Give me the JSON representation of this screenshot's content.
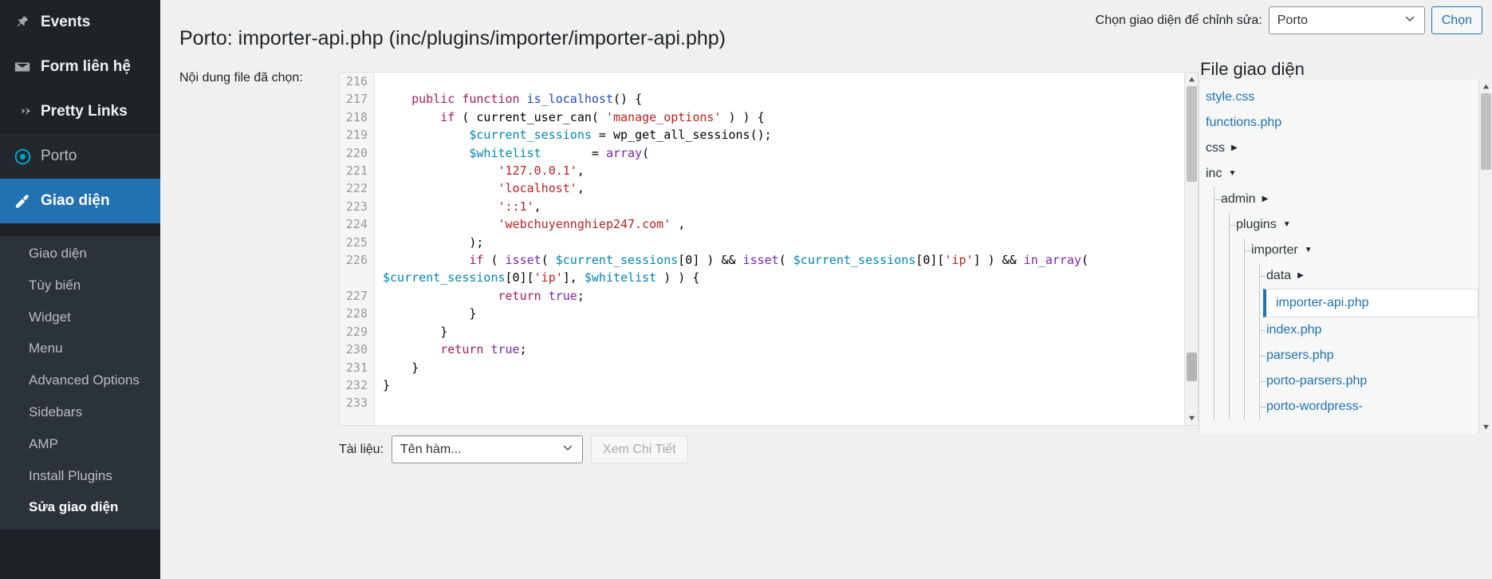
{
  "sidebar": {
    "top_items": [
      {
        "label": "Events",
        "icon": "pin-icon",
        "state": "normal"
      },
      {
        "label": "Form liên hệ",
        "icon": "mail-icon",
        "state": "normal"
      },
      {
        "label": "Pretty Links",
        "icon": "pretty-links-icon",
        "state": "normal"
      },
      {
        "label": "Porto",
        "icon": "porto-icon",
        "state": "highlighted"
      },
      {
        "label": "Giao diện",
        "icon": "appearance-brush-icon",
        "state": "current"
      }
    ],
    "submenu": [
      {
        "label": "Giao diện",
        "active": false
      },
      {
        "label": "Tùy biến",
        "active": false
      },
      {
        "label": "Widget",
        "active": false
      },
      {
        "label": "Menu",
        "active": false
      },
      {
        "label": "Advanced Options",
        "active": false
      },
      {
        "label": "Sidebars",
        "active": false
      },
      {
        "label": "AMP",
        "active": false
      },
      {
        "label": "Install Plugins",
        "active": false
      },
      {
        "label": "Sửa giao diện",
        "active": true
      }
    ]
  },
  "header": {
    "page_title": "Porto: importer-api.php (inc/plugins/importer/importer-api.php)",
    "content_label": "Nội dung file đã chọn:",
    "theme_picker_label": "Chọn giao diện để chỉnh sửa:",
    "theme_selected": "Porto",
    "theme_options": [
      "Porto"
    ],
    "select_button": "Chọn"
  },
  "editor": {
    "lines": [
      {
        "num": "216",
        "tokens": []
      },
      {
        "num": "217",
        "tokens": [
          {
            "t": "    ",
            "c": "pn"
          },
          {
            "t": "public",
            "c": "kw"
          },
          {
            "t": " ",
            "c": "pn"
          },
          {
            "t": "function",
            "c": "kw"
          },
          {
            "t": " ",
            "c": "pn"
          },
          {
            "t": "is_localhost",
            "c": "fn"
          },
          {
            "t": "() {",
            "c": "pn"
          }
        ]
      },
      {
        "num": "218",
        "tokens": [
          {
            "t": "        ",
            "c": "pn"
          },
          {
            "t": "if",
            "c": "kw"
          },
          {
            "t": " ( current_user_can( ",
            "c": "pn"
          },
          {
            "t": "'manage_options'",
            "c": "str"
          },
          {
            "t": " ) ) {",
            "c": "pn"
          }
        ]
      },
      {
        "num": "219",
        "tokens": [
          {
            "t": "            ",
            "c": "pn"
          },
          {
            "t": "$current_sessions",
            "c": "var"
          },
          {
            "t": " = wp_get_all_sessions();",
            "c": "pn"
          }
        ]
      },
      {
        "num": "220",
        "tokens": [
          {
            "t": "            ",
            "c": "pn"
          },
          {
            "t": "$whitelist",
            "c": "var"
          },
          {
            "t": "       = ",
            "c": "pn"
          },
          {
            "t": "array",
            "c": "kw2"
          },
          {
            "t": "(",
            "c": "pn"
          }
        ]
      },
      {
        "num": "221",
        "tokens": [
          {
            "t": "                ",
            "c": "pn"
          },
          {
            "t": "'127.0.0.1'",
            "c": "str"
          },
          {
            "t": ",",
            "c": "pn"
          }
        ]
      },
      {
        "num": "222",
        "tokens": [
          {
            "t": "                ",
            "c": "pn"
          },
          {
            "t": "'localhost'",
            "c": "str"
          },
          {
            "t": ",",
            "c": "pn"
          }
        ]
      },
      {
        "num": "223",
        "tokens": [
          {
            "t": "                ",
            "c": "pn"
          },
          {
            "t": "'::1'",
            "c": "str"
          },
          {
            "t": ",",
            "c": "pn"
          }
        ]
      },
      {
        "num": "224",
        "tokens": [
          {
            "t": "                ",
            "c": "pn"
          },
          {
            "t": "'webchuyennghiep247.com'",
            "c": "str"
          },
          {
            "t": " ,",
            "c": "pn"
          }
        ]
      },
      {
        "num": "225",
        "tokens": [
          {
            "t": "            );",
            "c": "pn"
          }
        ]
      },
      {
        "num": "226",
        "tokens": [
          {
            "t": "            ",
            "c": "pn"
          },
          {
            "t": "if",
            "c": "kw"
          },
          {
            "t": " ( ",
            "c": "pn"
          },
          {
            "t": "isset",
            "c": "kw2"
          },
          {
            "t": "( ",
            "c": "pn"
          },
          {
            "t": "$current_sessions",
            "c": "var"
          },
          {
            "t": "[0] ) && ",
            "c": "pn"
          },
          {
            "t": "isset",
            "c": "kw2"
          },
          {
            "t": "( ",
            "c": "pn"
          },
          {
            "t": "$current_sessions",
            "c": "var"
          },
          {
            "t": "[0][",
            "c": "pn"
          },
          {
            "t": "'ip'",
            "c": "str"
          },
          {
            "t": "] ) && ",
            "c": "pn"
          },
          {
            "t": "in_array",
            "c": "kw2"
          },
          {
            "t": "(",
            "c": "pn"
          }
        ],
        "wrap": [
          {
            "t": "$current_sessions",
            "c": "var"
          },
          {
            "t": "[0][",
            "c": "pn"
          },
          {
            "t": "'ip'",
            "c": "str"
          },
          {
            "t": "], ",
            "c": "pn"
          },
          {
            "t": "$whitelist",
            "c": "var"
          },
          {
            "t": " ) ) {",
            "c": "pn"
          }
        ]
      },
      {
        "num": "227",
        "tokens": [
          {
            "t": "                ",
            "c": "pn"
          },
          {
            "t": "return",
            "c": "kw"
          },
          {
            "t": " ",
            "c": "pn"
          },
          {
            "t": "true",
            "c": "kw2"
          },
          {
            "t": ";",
            "c": "pn"
          }
        ]
      },
      {
        "num": "228",
        "tokens": [
          {
            "t": "            }",
            "c": "pn"
          }
        ]
      },
      {
        "num": "229",
        "tokens": [
          {
            "t": "        }",
            "c": "pn"
          }
        ]
      },
      {
        "num": "230",
        "tokens": [
          {
            "t": "        ",
            "c": "pn"
          },
          {
            "t": "return",
            "c": "kw"
          },
          {
            "t": " ",
            "c": "pn"
          },
          {
            "t": "true",
            "c": "kw2"
          },
          {
            "t": ";",
            "c": "pn"
          }
        ]
      },
      {
        "num": "231",
        "tokens": [
          {
            "t": "    }",
            "c": "pn"
          }
        ]
      },
      {
        "num": "232",
        "tokens": [
          {
            "t": "}",
            "c": "pn"
          }
        ]
      },
      {
        "num": "233",
        "tokens": []
      }
    ]
  },
  "docs": {
    "label": "Tài liệu:",
    "function_selected": "Tên hàm...",
    "function_options": [
      "Tên hàm..."
    ],
    "detail_button": "Xem Chi Tiết"
  },
  "filetree": {
    "title": "File giao diện",
    "items": [
      {
        "label": "style.css",
        "type": "file",
        "depth": 0,
        "selected": false
      },
      {
        "label": "functions.php",
        "type": "file",
        "depth": 0,
        "selected": false
      },
      {
        "label": "css",
        "type": "dir",
        "depth": 0,
        "caret": "collapsed"
      },
      {
        "label": "inc",
        "type": "dir",
        "depth": 0,
        "caret": "expanded"
      },
      {
        "label": "admin",
        "type": "dir",
        "depth": 1,
        "caret": "collapsed"
      },
      {
        "label": "plugins",
        "type": "dir",
        "depth": 1,
        "caret": "expanded"
      },
      {
        "label": "importer",
        "type": "dir",
        "depth": 2,
        "caret": "expanded"
      },
      {
        "label": "data",
        "type": "dir",
        "depth": 3,
        "caret": "collapsed"
      },
      {
        "label": "importer-api.php",
        "type": "file",
        "depth": 3,
        "selected": true
      },
      {
        "label": "index.php",
        "type": "file",
        "depth": 3,
        "selected": false
      },
      {
        "label": "parsers.php",
        "type": "file",
        "depth": 3,
        "selected": false
      },
      {
        "label": "porto-parsers.php",
        "type": "file",
        "depth": 3,
        "selected": false
      },
      {
        "label": "porto-wordpress-",
        "type": "file",
        "depth": 3,
        "selected": false
      }
    ]
  },
  "colors": {
    "accent": "#2271b1",
    "sidebar_bg": "#1d2327",
    "submenu_bg": "#2c3338",
    "page_bg": "#f0f0f1"
  }
}
